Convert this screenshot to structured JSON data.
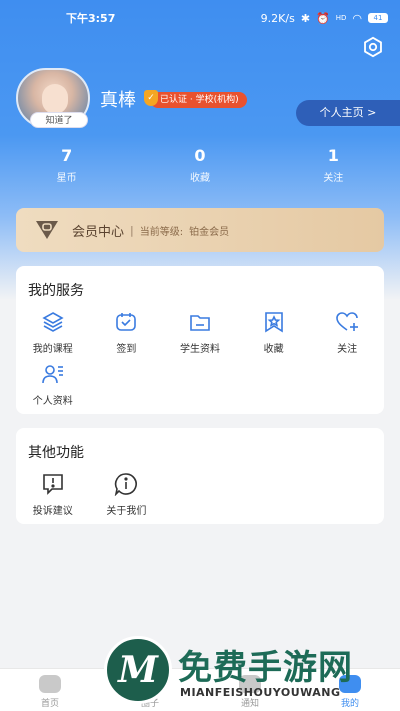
{
  "status_bar": {
    "time": "下午3:57",
    "net_speed": "9.2K/s",
    "signal": "HD",
    "battery": "41"
  },
  "profile": {
    "name": "真棒",
    "verify_badge": "✓",
    "verify_text": "已认证 · 学校(机构)",
    "avatar_tag": "知道了",
    "homepage_label": "个人主页 >"
  },
  "stats": [
    {
      "value": "7",
      "label": "星币"
    },
    {
      "value": "0",
      "label": "收藏"
    },
    {
      "value": "1",
      "label": "关注"
    }
  ],
  "vip": {
    "title": "会员中心",
    "separator": "|",
    "level_label": "当前等级:",
    "level_value": "铂金会员"
  },
  "services": {
    "title": "我的服务",
    "items": [
      {
        "label": "我的课程",
        "icon": "layers-icon"
      },
      {
        "label": "签到",
        "icon": "checkin-calendar-icon"
      },
      {
        "label": "学生资料",
        "icon": "folder-icon"
      },
      {
        "label": "收藏",
        "icon": "bookmark-star-icon"
      },
      {
        "label": "关注",
        "icon": "heart-plus-icon"
      },
      {
        "label": "个人资料",
        "icon": "user-profile-icon"
      }
    ]
  },
  "other": {
    "title": "其他功能",
    "items": [
      {
        "label": "投诉建议",
        "icon": "feedback-icon"
      },
      {
        "label": "关于我们",
        "icon": "info-icon"
      }
    ]
  },
  "bottom_nav": [
    {
      "label": "首页",
      "icon": "home-icon"
    },
    {
      "label": "圈子",
      "icon": "circle-icon"
    },
    {
      "label": "通知",
      "icon": "bell-icon"
    },
    {
      "label": "我的",
      "icon": "profile-icon",
      "active": true
    }
  ],
  "watermark": {
    "logo_letter": "M",
    "title": "免费手游网",
    "subtitle": "MIANFEISHOUYOUWANG"
  },
  "colors": {
    "primary": "#3f8ef0",
    "accent": "#3a7be0",
    "verify": "#e8522f",
    "vip_bg": "#e9d3b2",
    "watermark": "#1d6b57"
  }
}
